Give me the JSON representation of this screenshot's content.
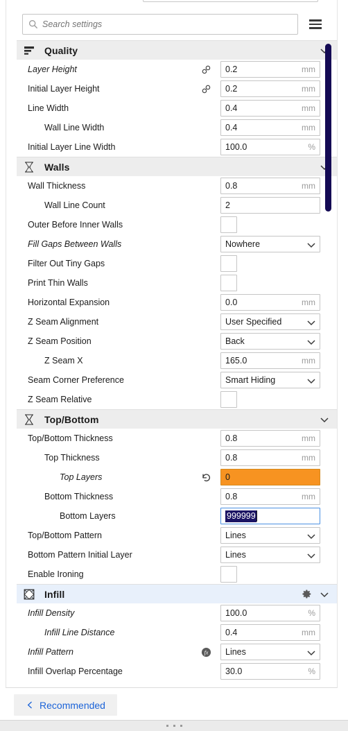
{
  "search": {
    "placeholder": "Search settings",
    "value": "",
    "icon": "search-icon",
    "menu_icon": "hamburger-menu-icon"
  },
  "categories": [
    {
      "id": "quality",
      "title": "Quality",
      "icon": "quality-icon",
      "expanded": true,
      "hovered": false,
      "has_gear": false,
      "settings": [
        {
          "label": "Layer Height",
          "indent": 0,
          "modified": true,
          "icon": "link-icon",
          "type": "field",
          "value": "0.2",
          "unit": "mm"
        },
        {
          "label": "Initial Layer Height",
          "indent": 0,
          "modified": false,
          "icon": "link-icon",
          "type": "field",
          "value": "0.2",
          "unit": "mm"
        },
        {
          "label": "Line Width",
          "indent": 0,
          "modified": false,
          "icon": null,
          "type": "field",
          "value": "0.4",
          "unit": "mm"
        },
        {
          "label": "Wall Line Width",
          "indent": 1,
          "modified": false,
          "icon": null,
          "type": "field",
          "value": "0.4",
          "unit": "mm"
        },
        {
          "label": "Initial Layer Line Width",
          "indent": 0,
          "modified": false,
          "icon": null,
          "type": "field",
          "value": "100.0",
          "unit": "%"
        }
      ]
    },
    {
      "id": "walls",
      "title": "Walls",
      "icon": "walls-icon",
      "expanded": true,
      "hovered": false,
      "has_gear": false,
      "settings": [
        {
          "label": "Wall Thickness",
          "indent": 0,
          "modified": false,
          "icon": null,
          "type": "field",
          "value": "0.8",
          "unit": "mm"
        },
        {
          "label": "Wall Line Count",
          "indent": 1,
          "modified": false,
          "icon": null,
          "type": "field",
          "value": "2",
          "unit": ""
        },
        {
          "label": "Outer Before Inner Walls",
          "indent": 0,
          "modified": false,
          "icon": null,
          "type": "checkbox",
          "value": false
        },
        {
          "label": "Fill Gaps Between Walls",
          "indent": 0,
          "modified": true,
          "icon": null,
          "type": "dropdown",
          "value": "Nowhere"
        },
        {
          "label": "Filter Out Tiny Gaps",
          "indent": 0,
          "modified": false,
          "icon": null,
          "type": "checkbox",
          "value": false
        },
        {
          "label": "Print Thin Walls",
          "indent": 0,
          "modified": false,
          "icon": null,
          "type": "checkbox",
          "value": false
        },
        {
          "label": "Horizontal Expansion",
          "indent": 0,
          "modified": false,
          "icon": null,
          "type": "field",
          "value": "0.0",
          "unit": "mm"
        },
        {
          "label": "Z Seam Alignment",
          "indent": 0,
          "modified": false,
          "icon": null,
          "type": "dropdown",
          "value": "User Specified"
        },
        {
          "label": "Z Seam Position",
          "indent": 0,
          "modified": false,
          "icon": null,
          "type": "dropdown",
          "value": "Back"
        },
        {
          "label": "Z Seam X",
          "indent": 1,
          "modified": false,
          "icon": null,
          "type": "field",
          "value": "165.0",
          "unit": "mm"
        },
        {
          "label": "Seam Corner Preference",
          "indent": 0,
          "modified": false,
          "icon": null,
          "type": "dropdown",
          "value": "Smart Hiding"
        },
        {
          "label": "Z Seam Relative",
          "indent": 0,
          "modified": false,
          "icon": null,
          "type": "checkbox",
          "value": false
        }
      ]
    },
    {
      "id": "top-bottom",
      "title": "Top/Bottom",
      "icon": "top-bottom-icon",
      "expanded": true,
      "hovered": false,
      "has_gear": false,
      "settings": [
        {
          "label": "Top/Bottom Thickness",
          "indent": 0,
          "modified": false,
          "icon": null,
          "type": "field",
          "value": "0.8",
          "unit": "mm"
        },
        {
          "label": "Top Thickness",
          "indent": 1,
          "modified": false,
          "icon": null,
          "type": "field",
          "value": "0.8",
          "unit": "mm"
        },
        {
          "label": "Top Layers",
          "indent": 2,
          "modified": true,
          "icon": "revert-icon",
          "type": "field",
          "value": "0",
          "unit": "",
          "state": "warning"
        },
        {
          "label": "Bottom Thickness",
          "indent": 1,
          "modified": false,
          "icon": null,
          "type": "field",
          "value": "0.8",
          "unit": "mm"
        },
        {
          "label": "Bottom Layers",
          "indent": 2,
          "modified": false,
          "icon": null,
          "type": "field",
          "value": "999999",
          "unit": "",
          "state": "focused-selected"
        },
        {
          "label": "Top/Bottom Pattern",
          "indent": 0,
          "modified": false,
          "icon": null,
          "type": "dropdown",
          "value": "Lines"
        },
        {
          "label": "Bottom Pattern Initial Layer",
          "indent": 0,
          "modified": false,
          "icon": null,
          "type": "dropdown",
          "value": "Lines"
        },
        {
          "label": "Enable Ironing",
          "indent": 0,
          "modified": false,
          "icon": null,
          "type": "checkbox",
          "value": false
        }
      ]
    },
    {
      "id": "infill",
      "title": "Infill",
      "icon": "infill-icon",
      "expanded": true,
      "hovered": true,
      "has_gear": true,
      "settings": [
        {
          "label": "Infill Density",
          "indent": 0,
          "modified": true,
          "icon": null,
          "type": "field",
          "value": "100.0",
          "unit": "%"
        },
        {
          "label": "Infill Line Distance",
          "indent": 1,
          "modified": true,
          "icon": null,
          "type": "field",
          "value": "0.4",
          "unit": "mm"
        },
        {
          "label": "Infill Pattern",
          "indent": 0,
          "modified": true,
          "icon": "fx-icon",
          "type": "dropdown",
          "value": "Lines"
        },
        {
          "label": "Infill Overlap Percentage",
          "indent": 0,
          "modified": false,
          "icon": null,
          "type": "field",
          "value": "30.0",
          "unit": "%"
        }
      ]
    }
  ],
  "footer": {
    "recommended_label": "Recommended",
    "recommended_icon": "chevron-left-icon",
    "resize_handle_icon": "drag-dots-icon"
  },
  "colors": {
    "warning": "#f79321",
    "selection": "#1b1464",
    "link_blue": "#1b63d8",
    "scrollbar": "#140a54",
    "category_header": "#ededed",
    "category_hover": "#e8f0fb"
  },
  "scrollbar": {
    "name": "vertical-scrollbar"
  }
}
